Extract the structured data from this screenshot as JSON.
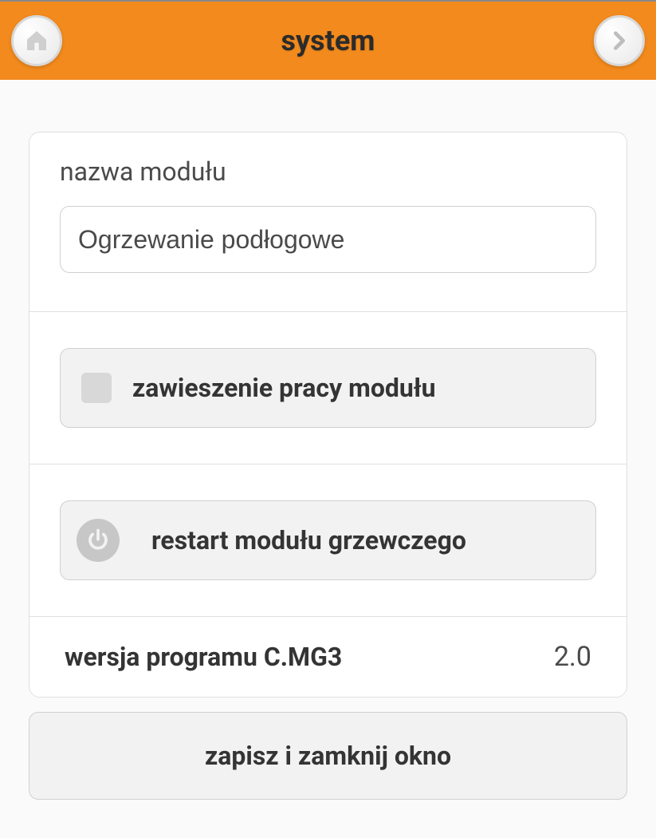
{
  "header": {
    "title": "system"
  },
  "module": {
    "name_label": "nazwa modułu",
    "name_value": "Ogrzewanie podłogowe",
    "suspend_label": "zawieszenie pracy modułu",
    "restart_label": "restart modułu grzewczego",
    "version_label": "wersja programu C.MG3",
    "version_value": "2.0"
  },
  "actions": {
    "save_close": "zapisz i zamknij okno"
  }
}
